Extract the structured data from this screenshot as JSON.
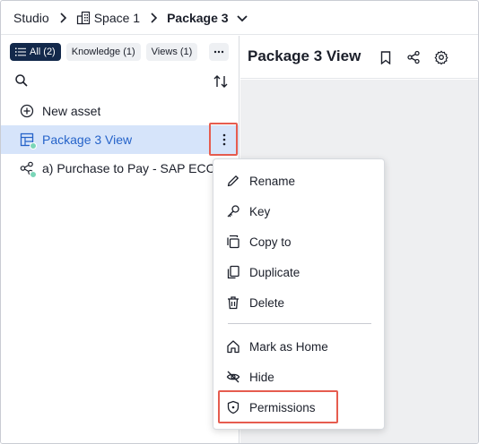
{
  "breadcrumb": {
    "studio": "Studio",
    "space": "Space 1",
    "package": "Package 3"
  },
  "filters": {
    "all": "All (2)",
    "knowledge": "Knowledge (1)",
    "views": "Views (1)",
    "more": "···"
  },
  "assets": {
    "new_asset": "New asset",
    "items": [
      {
        "label": "Package 3 View",
        "icon": "view-table-icon",
        "selected": true
      },
      {
        "label": "a) Purchase to Pay - SAP ECC ...",
        "icon": "knowledge-model-icon",
        "selected": false
      }
    ]
  },
  "view": {
    "title": "Package 3 View"
  },
  "menu": {
    "items": [
      {
        "label": "Rename",
        "icon": "pencil-icon"
      },
      {
        "label": "Key",
        "icon": "key-icon"
      },
      {
        "label": "Copy to",
        "icon": "copy-to-icon"
      },
      {
        "label": "Duplicate",
        "icon": "duplicate-icon"
      },
      {
        "label": "Delete",
        "icon": "trash-icon"
      },
      {
        "label": "Mark as Home",
        "icon": "home-icon"
      },
      {
        "label": "Hide",
        "icon": "eye-off-icon"
      },
      {
        "label": "Permissions",
        "icon": "shield-icon"
      }
    ]
  },
  "colors": {
    "accent": "#2563c9",
    "chip_active": "#13294b",
    "selected_row": "#d6e4fa",
    "highlight": "#e65c4f",
    "status": "#7bd6b8"
  }
}
